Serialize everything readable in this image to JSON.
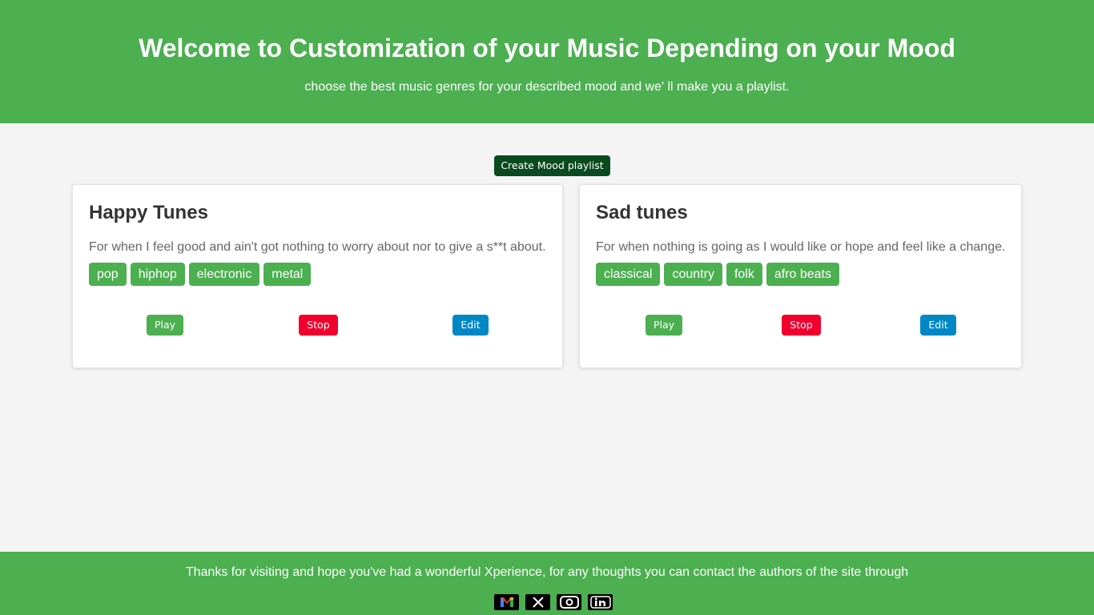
{
  "header": {
    "title": "Welcome to Customization of your Music Depending on your Mood",
    "subtitle": "choose the best music genres for your described mood and we' ll make you a playlist."
  },
  "create_button": "Create Mood playlist",
  "cards": [
    {
      "title": "Happy Tunes",
      "description": "For when I feel good and ain't got nothing to worry about nor to give a s**t about.",
      "tags": [
        "pop",
        "hiphop",
        "electronic",
        "metal"
      ],
      "play": "Play",
      "stop": "Stop",
      "edit": "Edit"
    },
    {
      "title": "Sad tunes",
      "description": "For when nothing is going as I would like or hope and feel like a change.",
      "tags": [
        "classical",
        "country",
        "folk",
        "afro beats"
      ],
      "play": "Play",
      "stop": "Stop",
      "edit": "Edit"
    }
  ],
  "footer": {
    "text": "Thanks for visiting and hope you've had a wonderful Xperience, for any thoughts you can contact the authors of the site through",
    "socials": [
      "gmail-icon",
      "x-icon",
      "instagram-icon",
      "linkedin-icon"
    ]
  },
  "colors": {
    "brand_green": "#4caf50",
    "dark_green": "#0a4a1f",
    "stop_red": "#f1002e",
    "edit_blue": "#0088c6"
  }
}
